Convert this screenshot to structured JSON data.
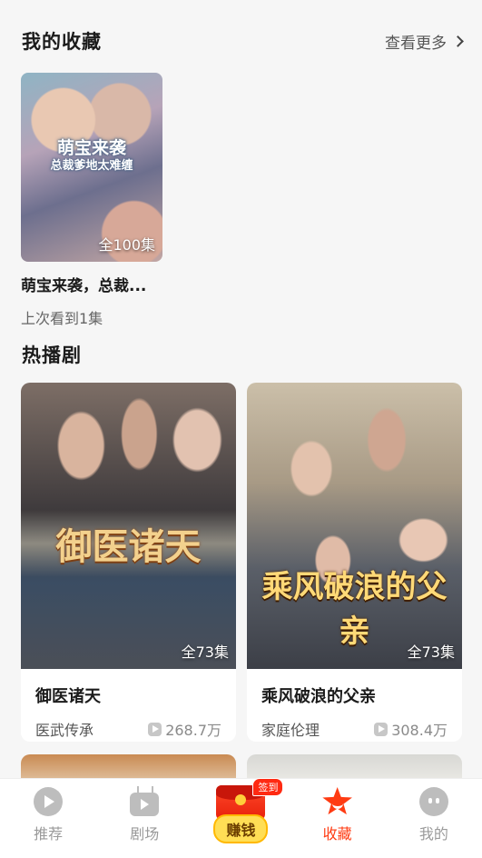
{
  "favorites": {
    "title": "我的收藏",
    "more_label": "查看更多",
    "items": [
      {
        "cover_title_line1": "萌宝来袭",
        "cover_title_line2": "总裁爹地太难缠",
        "episodes": "全100集",
        "name": "萌宝来袭，总裁...",
        "progress": "上次看到1集"
      }
    ]
  },
  "hot": {
    "title": "热播剧",
    "items": [
      {
        "cover_title": "御医诸天",
        "episodes": "全73集",
        "name": "御医诸天",
        "tag": "医武传承",
        "views": "268.7万"
      },
      {
        "cover_title": "乘风破浪的父亲",
        "episodes": "全73集",
        "name": "乘风破浪的父亲",
        "tag": "家庭伦理",
        "views": "308.4万"
      }
    ]
  },
  "tabbar": {
    "items": [
      {
        "label": "推荐",
        "icon": "play-circle-icon"
      },
      {
        "label": "剧场",
        "icon": "tv-icon"
      },
      {
        "label": "赚钱",
        "icon": "red-packet-icon",
        "badge": "签到"
      },
      {
        "label": "收藏",
        "icon": "star-icon",
        "active": true
      },
      {
        "label": "我的",
        "icon": "face-icon"
      }
    ]
  },
  "colors": {
    "accent": "#ff3b12",
    "earn_yellow": "#ffde55",
    "background": "#f6f6f6"
  }
}
